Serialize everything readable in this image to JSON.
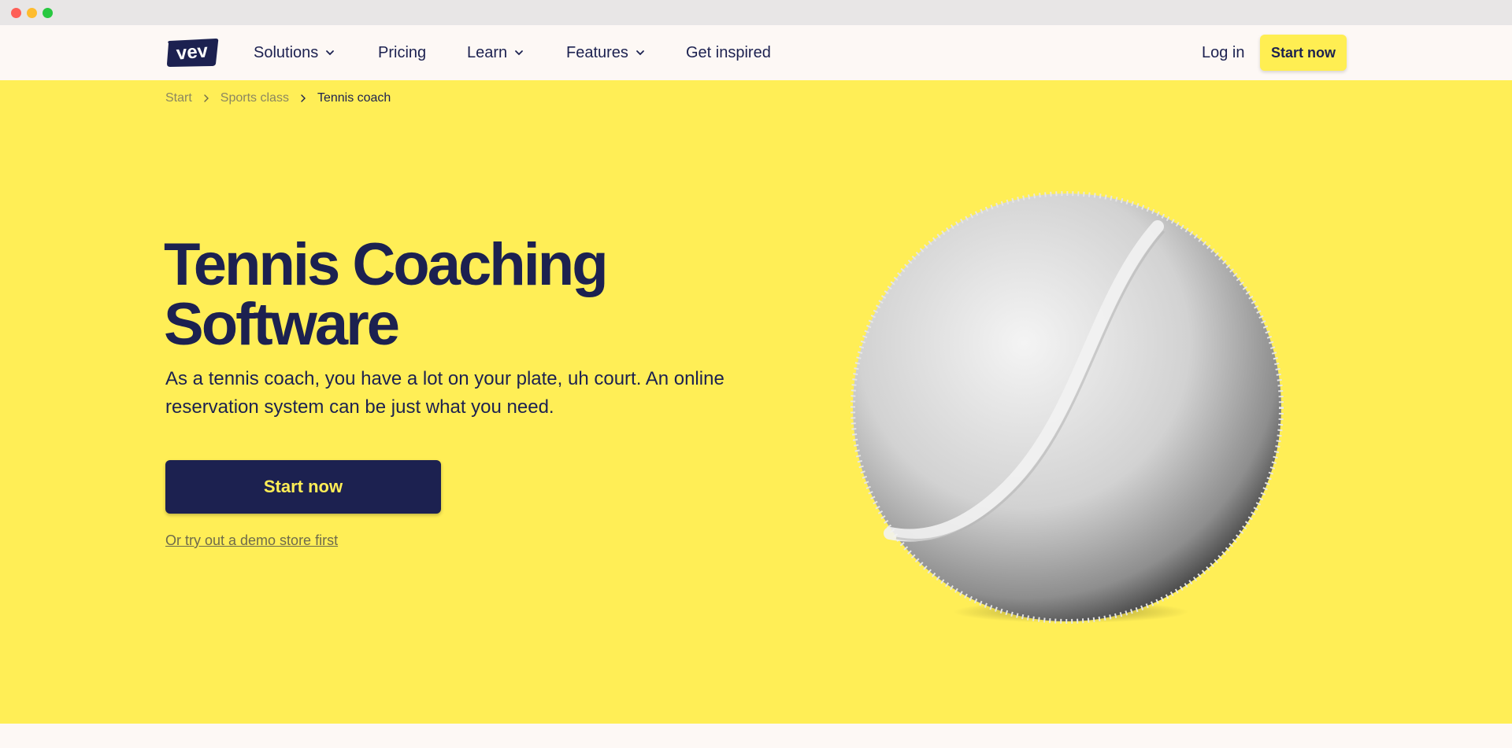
{
  "logo_text": "vev",
  "nav": {
    "items": [
      {
        "label": "Solutions",
        "has_dropdown": true
      },
      {
        "label": "Pricing",
        "has_dropdown": false
      },
      {
        "label": "Learn",
        "has_dropdown": true
      },
      {
        "label": "Features",
        "has_dropdown": true
      },
      {
        "label": "Get inspired",
        "has_dropdown": false
      }
    ],
    "login": "Log in",
    "cta": "Start now"
  },
  "breadcrumb": {
    "items": [
      "Start",
      "Sports class"
    ],
    "current": "Tennis coach"
  },
  "hero": {
    "title": "Tennis Coaching Software",
    "subtitle": "As a tennis coach, you have a lot on your plate, uh court. An online reservation system can be just what you need.",
    "cta": "Start now",
    "demo_link": "Or try out a demo store first"
  },
  "colors": {
    "accent_yellow": "#ffee56",
    "navy": "#1c2150",
    "page_bg": "#fdf8f5"
  }
}
